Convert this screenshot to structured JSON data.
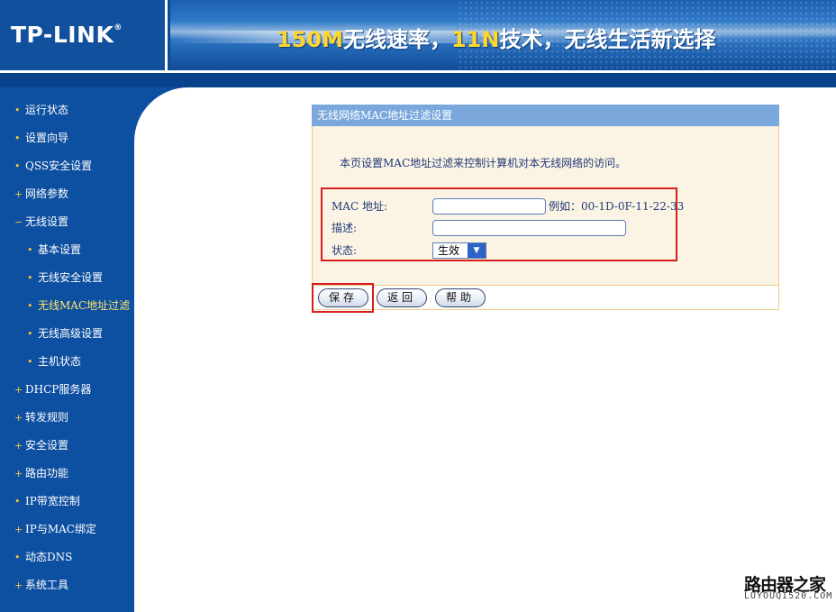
{
  "header": {
    "logo": "TP-LINK",
    "logo_mark": "®",
    "slogan_parts": [
      "150M",
      "无线速率，",
      "11N",
      "技术，无线生活新选择"
    ]
  },
  "sidebar": {
    "items": [
      {
        "label": "运行状态",
        "bullet": "•"
      },
      {
        "label": "设置向导",
        "bullet": "•"
      },
      {
        "label": "QSS安全设置",
        "bullet": "•"
      },
      {
        "label": "网络参数",
        "bullet": "+"
      },
      {
        "label": "无线设置",
        "bullet": "−"
      },
      {
        "label": "基本设置",
        "bullet": "•"
      },
      {
        "label": "无线安全设置",
        "bullet": "•"
      },
      {
        "label": "无线MAC地址过滤",
        "bullet": "•"
      },
      {
        "label": "无线高级设置",
        "bullet": "•"
      },
      {
        "label": "主机状态",
        "bullet": "•"
      },
      {
        "label": "DHCP服务器",
        "bullet": "+"
      },
      {
        "label": "转发规则",
        "bullet": "+"
      },
      {
        "label": "安全设置",
        "bullet": "+"
      },
      {
        "label": "路由功能",
        "bullet": "+"
      },
      {
        "label": "IP带宽控制",
        "bullet": "•"
      },
      {
        "label": "IP与MAC绑定",
        "bullet": "+"
      },
      {
        "label": "动态DNS",
        "bullet": "•"
      },
      {
        "label": "系统工具",
        "bullet": "+"
      }
    ]
  },
  "panel": {
    "title": "无线网络MAC地址过滤设置",
    "description": "本页设置MAC地址过滤来控制计算机对本无线网络的访问。",
    "mac_label": "MAC 地址:",
    "mac_value": "",
    "mac_example": "例如：00-1D-0F-11-22-33",
    "desc_label": "描述:",
    "desc_value": "",
    "status_label": "状态:",
    "status_value": "生效"
  },
  "buttons": {
    "save": "保存",
    "back": "返回",
    "help": "帮助"
  },
  "watermark": {
    "top": "路由器之家",
    "bottom": "LUYOUQI520.COM"
  },
  "colors": {
    "sidebar_bg": "#0d4fa0",
    "panel_title_bg": "#7aa7dc",
    "panel_body_bg": "#fbf3e4",
    "highlight_red": "#d51e1e",
    "slogan_accent": "#ffd62e"
  }
}
